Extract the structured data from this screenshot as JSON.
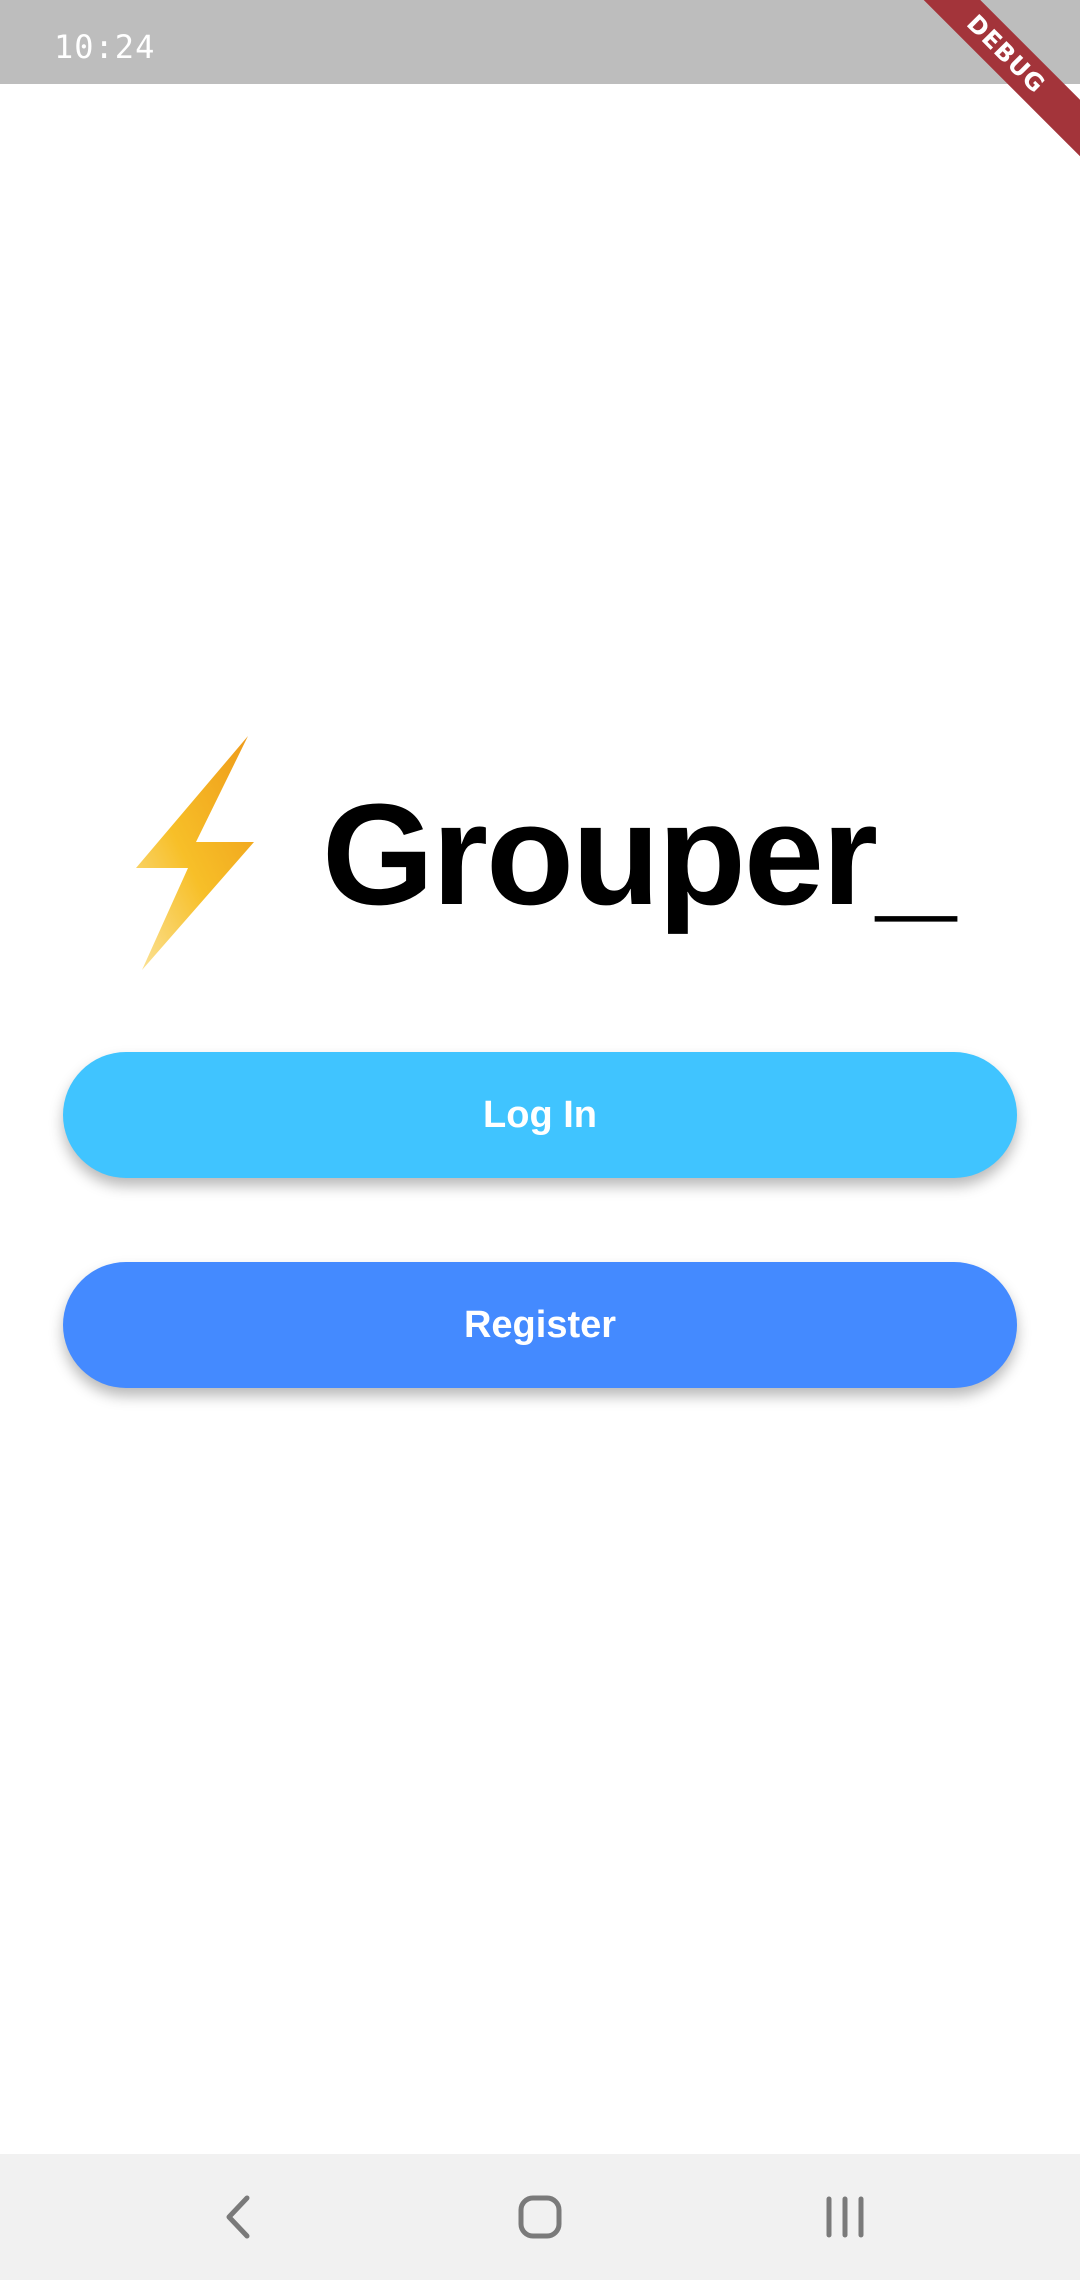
{
  "status_bar": {
    "time": "10:24"
  },
  "debug_banner": {
    "label": "DEBUG"
  },
  "brand": {
    "logo_icon": "lightning-bolt-icon",
    "title": "Grouper_"
  },
  "buttons": {
    "login_label": "Log In",
    "register_label": "Register"
  },
  "nav_bar": {
    "back_icon": "back-chevron-icon",
    "home_icon": "home-square-icon",
    "recents_icon": "recents-bars-icon"
  },
  "colors": {
    "status_bar": "#bdbdbd",
    "login_button": "#40c4ff",
    "register_button": "#448aff",
    "debug_ribbon": "#a3343a",
    "bolt_light": "#f9d26b",
    "bolt_dark": "#f0a21a",
    "nav_bar": "#f1f1f1",
    "nav_icon": "#7a7a7a"
  }
}
